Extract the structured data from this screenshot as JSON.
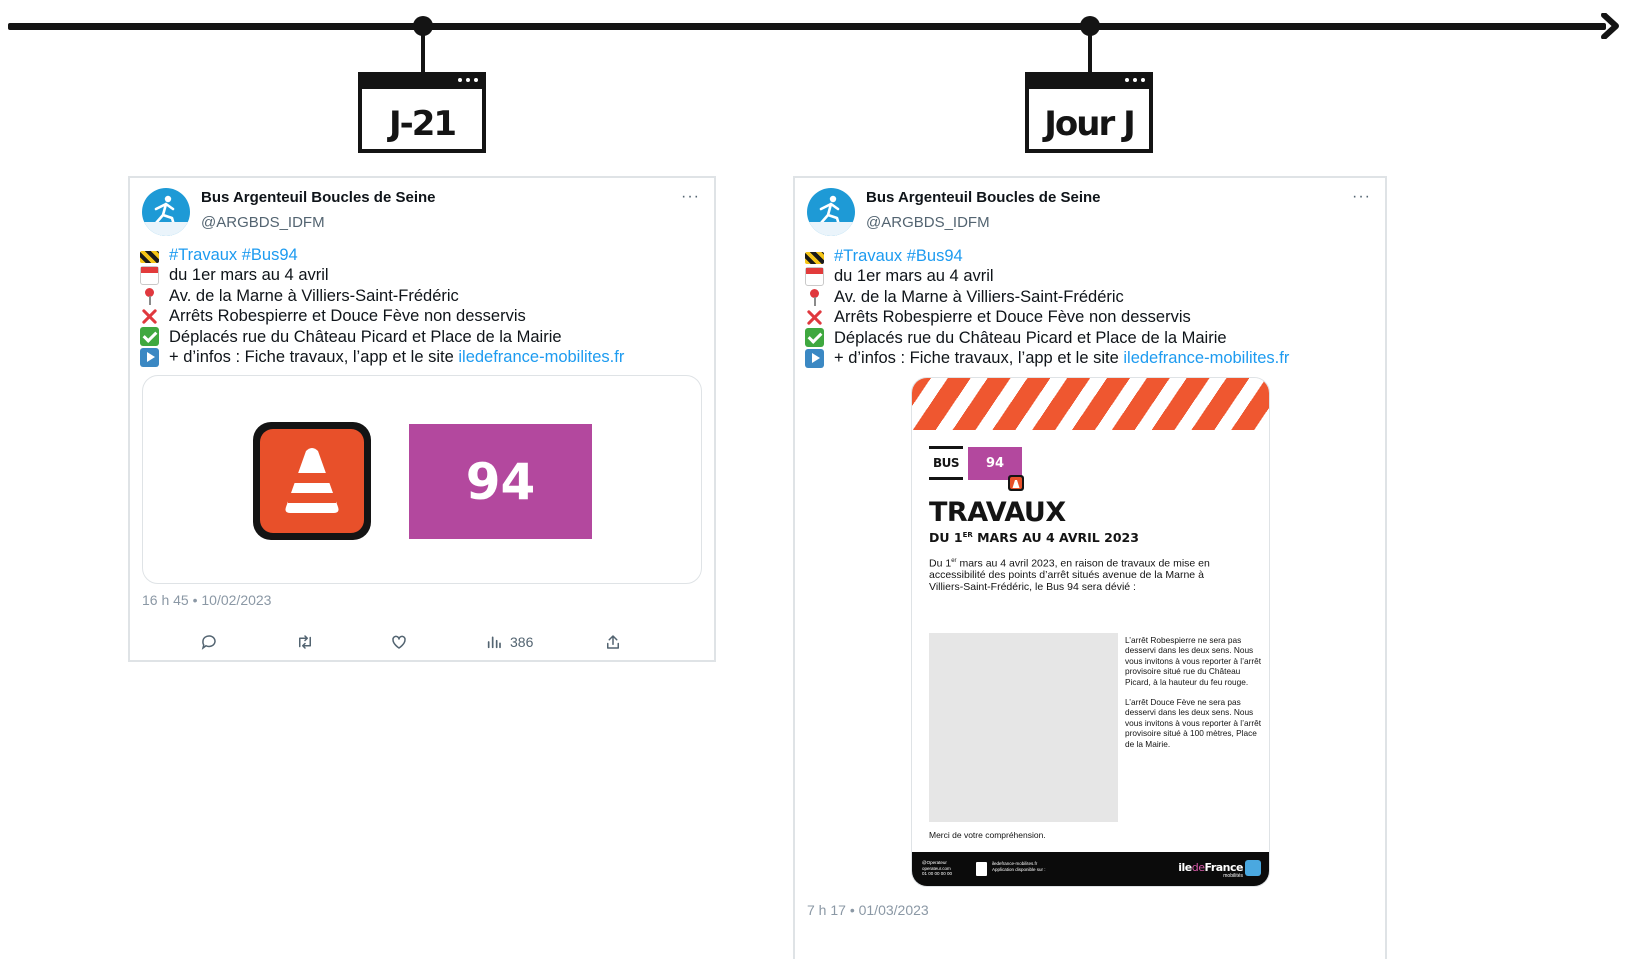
{
  "timeline": {
    "milestones": [
      {
        "label": "J-21"
      },
      {
        "label": "Jour J"
      }
    ]
  },
  "tweets": [
    {
      "author_name": "Bus Argenteuil Boucles de Seine",
      "author_handle": "@ARGBDS_IDFM",
      "more_icon": "more-horizontal-icon",
      "lines": [
        {
          "icon": "construction-icon",
          "segments": [
            {
              "text": "#Travaux #Bus94",
              "type": "hashtag"
            }
          ]
        },
        {
          "icon": "calendar-icon",
          "segments": [
            {
              "text": "du 1er mars au 4 avril",
              "type": "text"
            }
          ]
        },
        {
          "icon": "round-pushpin-icon",
          "segments": [
            {
              "text": "Av. de la Marne à Villiers-Saint-Frédéric",
              "type": "text"
            }
          ]
        },
        {
          "icon": "cross-mark-icon",
          "segments": [
            {
              "text": "Arrêts Robespierre et Douce Fève non desservis",
              "type": "text"
            }
          ]
        },
        {
          "icon": "check-mark-icon",
          "segments": [
            {
              "text": "Déplacés rue du Château Picard et Place de la Mairie",
              "type": "text"
            }
          ]
        },
        {
          "icon": "play-button-icon",
          "segments": [
            {
              "text": "+ d’infos : Fiche travaux, l’app et le site ",
              "type": "text"
            },
            {
              "text": "iledefrance-mobilites.fr",
              "type": "link"
            }
          ]
        }
      ],
      "media": {
        "line_number": "94",
        "icon": "traffic-cone-icon"
      },
      "timestamp": "16 h 45 • 10/02/2023",
      "actions": {
        "reply_icon": "reply-icon",
        "retweet_icon": "retweet-icon",
        "like_icon": "like-icon",
        "views_icon": "views-icon",
        "views_count": "386",
        "share_icon": "share-icon"
      }
    },
    {
      "author_name": "Bus Argenteuil Boucles de Seine",
      "author_handle": "@ARGBDS_IDFM",
      "more_icon": "more-horizontal-icon",
      "lines": [
        {
          "icon": "construction-icon",
          "segments": [
            {
              "text": "#Travaux #Bus94",
              "type": "hashtag"
            }
          ]
        },
        {
          "icon": "calendar-icon",
          "segments": [
            {
              "text": "du 1er mars au 4 avril",
              "type": "text"
            }
          ]
        },
        {
          "icon": "round-pushpin-icon",
          "segments": [
            {
              "text": "Av. de la Marne à Villiers-Saint-Frédéric",
              "type": "text"
            }
          ]
        },
        {
          "icon": "cross-mark-icon",
          "segments": [
            {
              "text": "Arrêts Robespierre et Douce Fève non desservis",
              "type": "text"
            }
          ]
        },
        {
          "icon": "check-mark-icon",
          "segments": [
            {
              "text": "Déplacés rue du Château Picard et Place de la Mairie",
              "type": "text"
            }
          ]
        },
        {
          "icon": "play-button-icon",
          "segments": [
            {
              "text": "+ d’infos : Fiche travaux, l’app et le site ",
              "type": "text"
            },
            {
              "text": "iledefrance-mobilites.fr",
              "type": "link"
            }
          ]
        }
      ],
      "poster": {
        "mode": "BUS",
        "line_number": "94",
        "title": "TRAVAUX",
        "subtitle_prefix": "DU 1",
        "subtitle_sup": "ER",
        "subtitle_rest": " MARS AU 4 AVRIL 2023",
        "intro_prefix": "Du 1",
        "intro_sup": "er",
        "intro_rest": " mars au 4 avril 2023, en raison de travaux de mise en accessibilité des points d’arrêt situés avenue de la Marne à Villiers-Saint-Frédéric, le Bus 94 sera dévié :",
        "note_1": "L’arrêt Robespierre ne sera pas desservi dans les deux sens. Nous vous invitons à vous reporter à l’arrêt provisoire situé rue du Château Picard, à la hauteur du feu rouge.",
        "note_2": "L’arrêt Douce Fève ne sera pas desservi dans les deux sens. Nous vous invitons à vous reporter à l’arrêt provisoire situé à 100 mètres, Place de la Mairie.",
        "thanks": "Merci de votre compréhension.",
        "footer": {
          "social": "@Operateur",
          "site": "operateur.com",
          "phone": "01 00 00 00 00",
          "idfm_site": "iledefrance-mobilites.fr",
          "app_line": "Application disponible sur :",
          "brand_ile": "ile",
          "brand_de": "de",
          "brand_france": "France",
          "brand_sub": "mobilités"
        }
      },
      "timestamp": "7 h 17 • 01/03/2023"
    }
  ],
  "colors": {
    "hashtag_link": "#1d9bf0",
    "line_94": "#b3489e",
    "cone_orange": "#e8502a",
    "stripe_orange": "#ef5730"
  }
}
